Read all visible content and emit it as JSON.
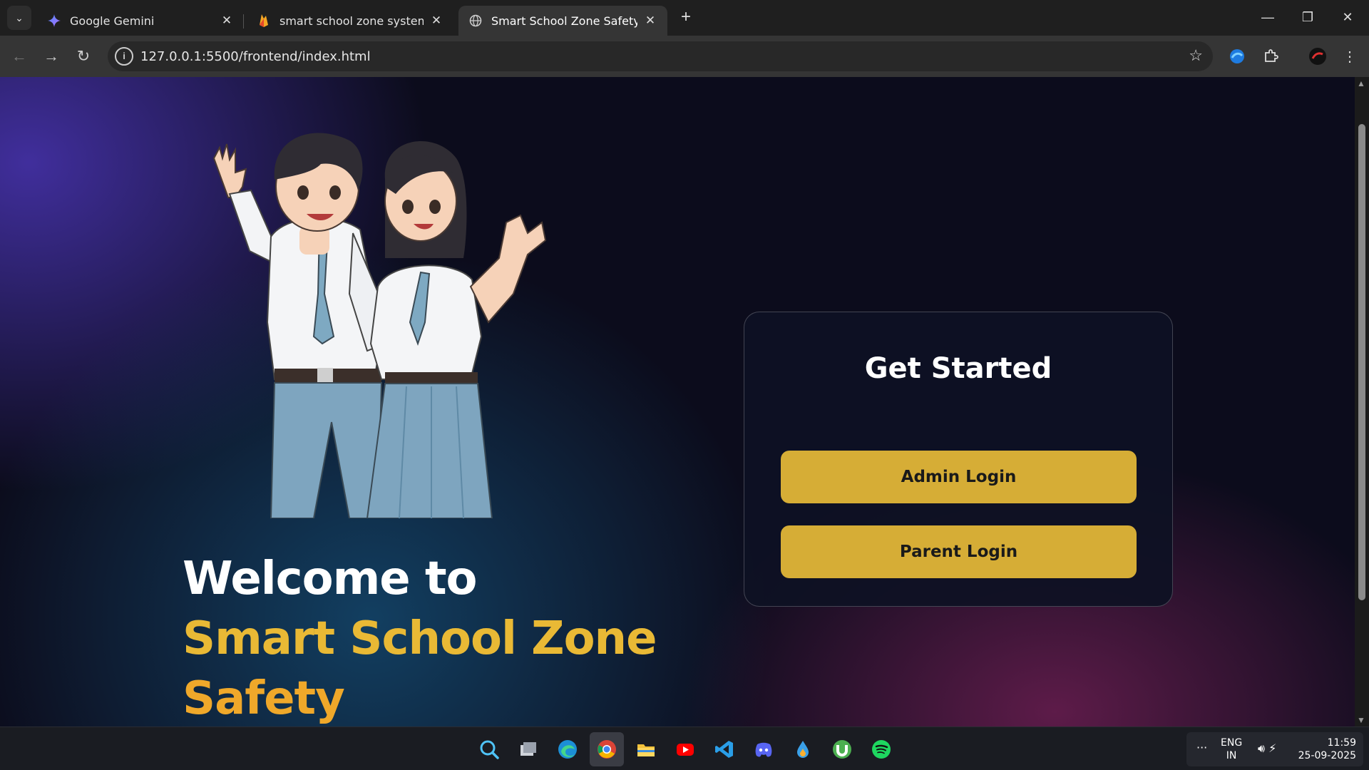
{
  "browser": {
    "tabs": [
      {
        "title": "Google Gemini",
        "icon": "gemini-icon"
      },
      {
        "title": "smart school zone system – Dat",
        "icon": "firebase-icon"
      },
      {
        "title": "Smart School Zone Safety - Wel",
        "icon": "globe-icon",
        "active": true
      }
    ],
    "new_tab": "+",
    "url": "127.0.0.1:5500/frontend/index.html"
  },
  "page": {
    "welcome_line1": "Welcome to",
    "welcome_line2": "Smart School Zone",
    "welcome_line3": "Safety",
    "card_title": "Get Started",
    "admin_login": "Admin Login",
    "parent_login": "Parent Login",
    "colors": {
      "accent": "#d6ad36",
      "title_gold": "#e9b935",
      "title_orange": "#efa82a"
    }
  },
  "taskbar": {
    "apps": [
      "search-icon",
      "task-view-icon",
      "edge-icon",
      "chrome-icon",
      "file-explorer-icon",
      "youtube-icon",
      "vscode-icon",
      "discord-icon",
      "drop-icon",
      "utorrent-icon",
      "spotify-icon"
    ],
    "tray_more": "···",
    "lang_line1": "ENG",
    "lang_line2": "IN",
    "time": "11:59",
    "date": "25-09-2025"
  }
}
